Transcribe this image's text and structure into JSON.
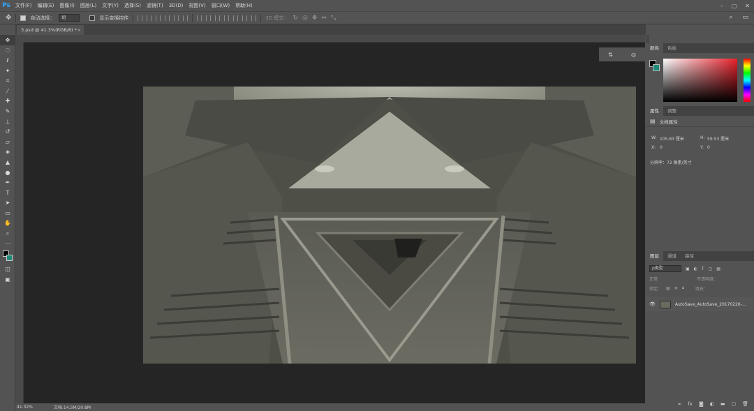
{
  "menubar": {
    "logo": "Ps",
    "items": [
      "文件(F)",
      "编辑(E)",
      "图像(I)",
      "图层(L)",
      "文字(Y)",
      "选择(S)",
      "滤镜(T)",
      "3D(D)",
      "视图(V)",
      "窗口(W)",
      "帮助(H)"
    ],
    "win_controls": [
      "–",
      "▢",
      "✕"
    ]
  },
  "options": {
    "auto_select_label": "自动选择：",
    "auto_select_value": "组",
    "show_transform_label": "显示变换控件",
    "mode_label": "3D 模式："
  },
  "document": {
    "tab_label": "3.psd @ 41.3%(RGB/8) *",
    "close": "×"
  },
  "status": {
    "zoom": "41.32%",
    "doc_size": "文档:14.5M/20.8M"
  },
  "color_panel": {
    "tabs": [
      "颜色",
      "色板"
    ],
    "fg_color": "#000000",
    "bg_color": "#1e8a78"
  },
  "properties_panel": {
    "tabs": [
      "属性",
      "调整"
    ],
    "title": "文档属性",
    "w_label": "W:",
    "w_value": "105.83 厘米",
    "h_label": "H:",
    "h_value": "59.53 厘米",
    "x_label": "X:",
    "x_value": "0",
    "y_label": "Y:",
    "y_value": "0",
    "resolution": "分辨率：72 像素/英寸"
  },
  "layers_panel": {
    "tabs": [
      "图层",
      "通道",
      "路径"
    ],
    "filter_label": "ρ类型",
    "blend_mode": "正常",
    "opacity_label": "不透明度：",
    "lock_label": "锁定：",
    "fill_label": "填充：",
    "layer_name": "AutoSave_AutoSave_20170226-..."
  }
}
